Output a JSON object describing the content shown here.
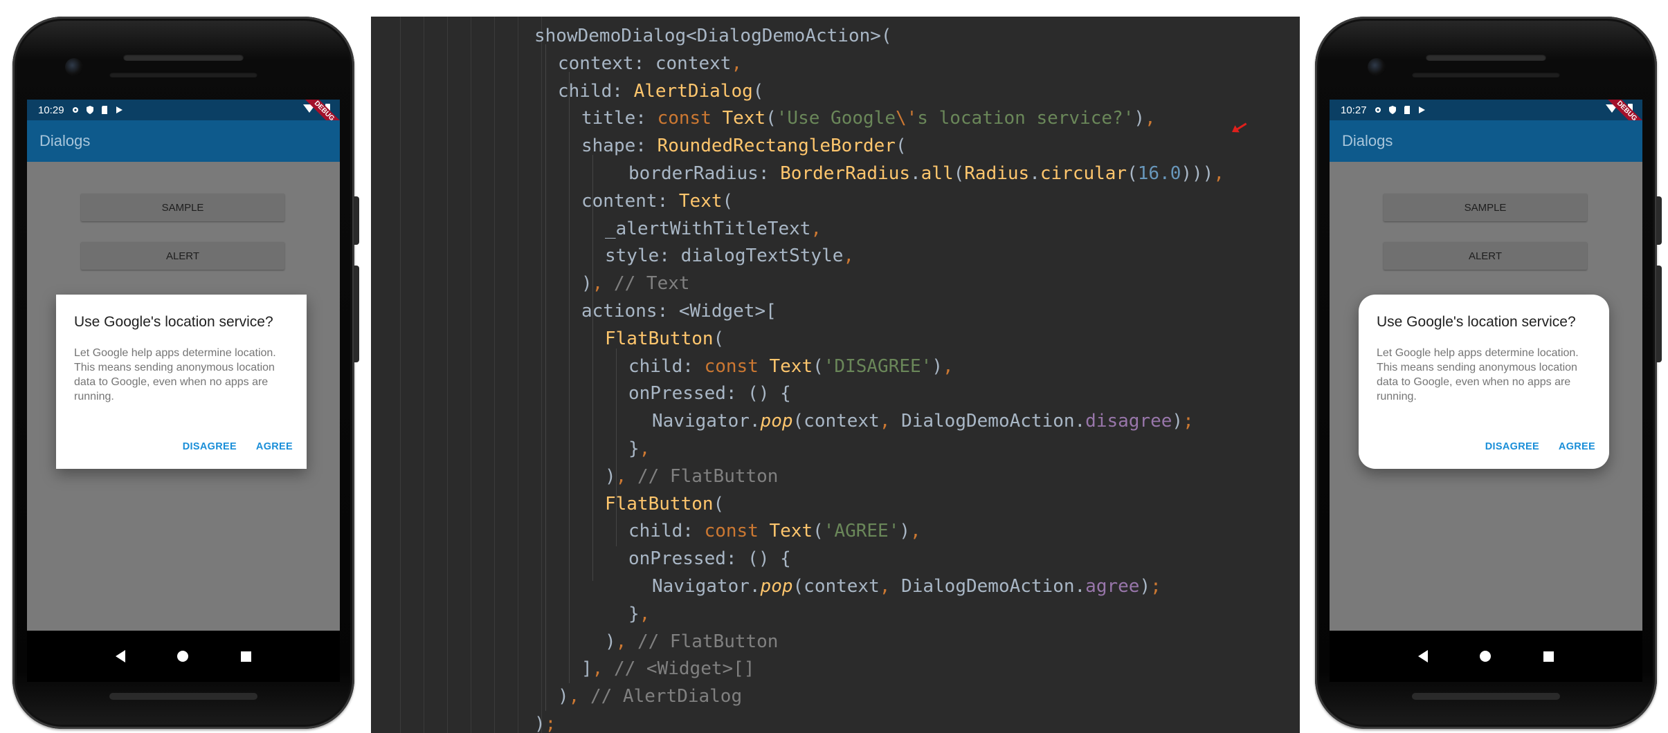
{
  "left_phone": {
    "status_time": "10:29",
    "debug_banner": "DEBUG",
    "appbar_title": "Dialogs",
    "buttons": [
      "SAMPLE",
      "ALERT"
    ],
    "dialog": {
      "title": "Use Google's location service?",
      "body": "Let Google help apps determine location. This means sending anonymous location data to Google, even when no apps are running.",
      "disagree": "DISAGREE",
      "agree": "AGREE"
    }
  },
  "right_phone": {
    "status_time": "10:27",
    "debug_banner": "DEBUG",
    "appbar_title": "Dialogs",
    "buttons": [
      "SAMPLE",
      "ALERT"
    ],
    "dialog": {
      "title": "Use Google's location service?",
      "body": "Let Google help apps determine location. This means sending anonymous location data to Google, even when no apps are running.",
      "disagree": "DISAGREE",
      "agree": "AGREE"
    }
  },
  "code": {
    "lines": [
      [
        [
          "p",
          "showDemoDialog<DialogDemoAction>("
        ]
      ],
      [
        [
          "p",
          "context: context"
        ],
        [
          "kw",
          ","
        ]
      ],
      [
        [
          "p",
          "child: "
        ],
        [
          "cls",
          "AlertDialog"
        ],
        [
          "p",
          "("
        ]
      ],
      [
        [
          "p",
          "title: "
        ],
        [
          "kw",
          "const "
        ],
        [
          "cls",
          "Text"
        ],
        [
          "p",
          "("
        ],
        [
          "str",
          "'Use Google"
        ],
        [
          "esc",
          "\\'"
        ],
        [
          "str",
          "s location service?'"
        ],
        [
          "p",
          ")"
        ],
        [
          "kw",
          ","
        ]
      ],
      [
        [
          "p",
          "shape: "
        ],
        [
          "cls",
          "RoundedRectangleBorder"
        ],
        [
          "p",
          "("
        ]
      ],
      [
        [
          "p",
          "borderRadius: "
        ],
        [
          "cls",
          "BorderRadius"
        ],
        [
          "p",
          "."
        ],
        [
          "cls",
          "all"
        ],
        [
          "p",
          "("
        ],
        [
          "cls",
          "Radius"
        ],
        [
          "p",
          "."
        ],
        [
          "cls",
          "circular"
        ],
        [
          "p",
          "("
        ],
        [
          "num",
          "16.0"
        ],
        [
          "p",
          ")))"
        ],
        [
          "kw",
          ","
        ]
      ],
      [
        [
          "p",
          "content: "
        ],
        [
          "cls",
          "Text"
        ],
        [
          "p",
          "("
        ]
      ],
      [
        [
          "p",
          "_alertWithTitleText"
        ],
        [
          "kw",
          ","
        ]
      ],
      [
        [
          "p",
          "style: dialogTextStyle"
        ],
        [
          "kw",
          ","
        ]
      ],
      [
        [
          "p",
          ")"
        ],
        [
          "kw",
          ", "
        ],
        [
          "cmt",
          "// Text"
        ]
      ],
      [
        [
          "p",
          "actions: <Widget>["
        ]
      ],
      [
        [
          "cls",
          "FlatButton"
        ],
        [
          "p",
          "("
        ]
      ],
      [
        [
          "p",
          "child: "
        ],
        [
          "kw",
          "const "
        ],
        [
          "cls",
          "Text"
        ],
        [
          "p",
          "("
        ],
        [
          "str",
          "'DISAGREE'"
        ],
        [
          "p",
          ")"
        ],
        [
          "kw",
          ","
        ]
      ],
      [
        [
          "p",
          "onPressed: () {"
        ]
      ],
      [
        [
          "p",
          "Navigator."
        ],
        [
          "it",
          "pop"
        ],
        [
          "p",
          "(context"
        ],
        [
          "kw",
          ", "
        ],
        [
          "p",
          "DialogDemoAction."
        ],
        [
          "fld",
          "disagree"
        ],
        [
          "p",
          ")"
        ],
        [
          "kw",
          ";"
        ]
      ],
      [
        [
          "p",
          "}"
        ],
        [
          "kw",
          ","
        ]
      ],
      [
        [
          "p",
          ")"
        ],
        [
          "kw",
          ", "
        ],
        [
          "cmt",
          "// FlatButton"
        ]
      ],
      [
        [
          "cls",
          "FlatButton"
        ],
        [
          "p",
          "("
        ]
      ],
      [
        [
          "p",
          "child: "
        ],
        [
          "kw",
          "const "
        ],
        [
          "cls",
          "Text"
        ],
        [
          "p",
          "("
        ],
        [
          "str",
          "'AGREE'"
        ],
        [
          "p",
          ")"
        ],
        [
          "kw",
          ","
        ]
      ],
      [
        [
          "p",
          "onPressed: () {"
        ]
      ],
      [
        [
          "p",
          "Navigator."
        ],
        [
          "it",
          "pop"
        ],
        [
          "p",
          "(context"
        ],
        [
          "kw",
          ", "
        ],
        [
          "p",
          "DialogDemoAction."
        ],
        [
          "fld",
          "agree"
        ],
        [
          "p",
          ")"
        ],
        [
          "kw",
          ";"
        ]
      ],
      [
        [
          "p",
          "}"
        ],
        [
          "kw",
          ","
        ]
      ],
      [
        [
          "p",
          ")"
        ],
        [
          "kw",
          ", "
        ],
        [
          "cmt",
          "// FlatButton"
        ]
      ],
      [
        [
          "p",
          "]"
        ],
        [
          "kw",
          ", "
        ],
        [
          "cmt",
          "// <Widget>[]"
        ]
      ],
      [
        [
          "p",
          ")"
        ],
        [
          "kw",
          ", "
        ],
        [
          "cmt",
          "// AlertDialog"
        ]
      ],
      [
        [
          "p",
          ")"
        ],
        [
          "kw",
          ";"
        ]
      ]
    ]
  }
}
